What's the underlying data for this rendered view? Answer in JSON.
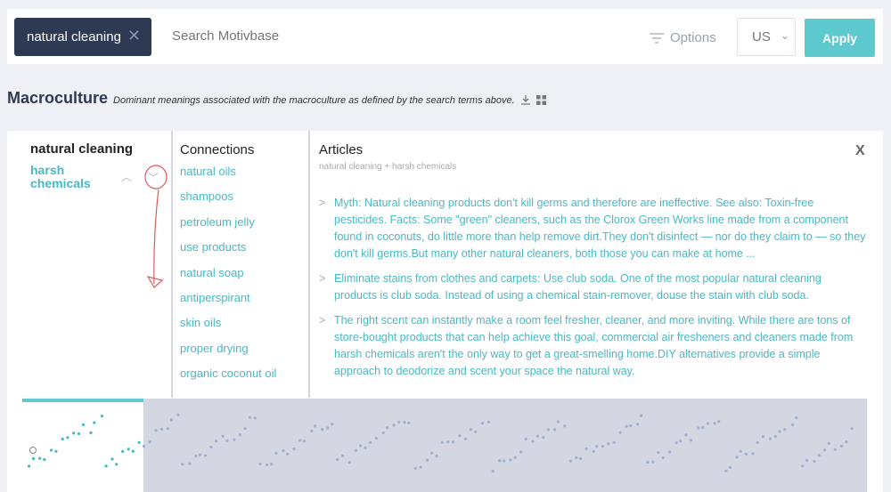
{
  "search": {
    "term_chip": "natural cleaning",
    "clear_icon": "close-icon",
    "placeholder": "Search Motivbase",
    "options_label": "Options",
    "country": "US",
    "apply_label": "Apply"
  },
  "macroculture": {
    "title": "Macroculture",
    "subtitle": "Dominant meanings associated with the macroculture as defined by the search terms above."
  },
  "terms": {
    "main": "natural cleaning",
    "selected": "harsh chemicals"
  },
  "connections": {
    "header": "Connections",
    "items": [
      "natural oils",
      "shampoos",
      "petroleum jelly",
      "use products",
      "natural soap",
      "antiperspirant",
      "skin oils",
      "proper drying",
      "organic coconut oil"
    ]
  },
  "articles": {
    "header": "Articles",
    "subheader": "natural cleaning + harsh chemicals",
    "close_label": "X",
    "bullet": ">",
    "items": [
      "Myth: Natural cleaning products don't kill germs and therefore are ineffective. See also: Toxin-free pesticides. Facts: Some \"green\" cleaners, such as the Clorox Green Works line made from a component found in coconuts, do little more than help remove dirt.They don't disinfect — nor do they claim to — so they don't kill germs.But many other natural cleaners, both those you can make at home ...",
      "Eliminate stains from clothes and carpets: Use club soda. One of the most popular natural cleaning products is club soda. Instead of using a chemical stain-remover, douse the stain with club soda.",
      "The right scent can instantly make a room feel fresher, cleaner, and more inviting. While there are tons of store-bought products that can help achieve this goal, commercial air fresheners and cleaners made from harsh chemicals aren't the only way to get a great-smelling home.DIY alternatives provide a simple approach to deodorize and scent your space the natural way."
    ]
  },
  "colors": {
    "accent": "#5ec9cf",
    "chip_bg": "#2e3a53",
    "link": "#4ab8c4",
    "annotation": "#e05a5a"
  }
}
